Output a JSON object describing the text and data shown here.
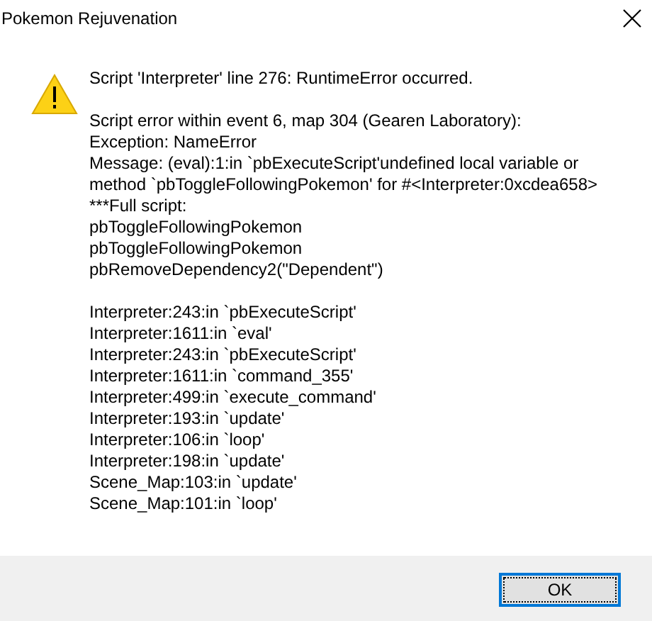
{
  "window": {
    "title": "Pokemon Rejuvenation"
  },
  "message_blocks": [
    [
      "Script 'Interpreter' line 276: RuntimeError occurred."
    ],
    [
      "Script error within event 6, map 304 (Gearen Laboratory):",
      "Exception: NameError",
      "Message: (eval):1:in `pbExecuteScript'undefined local variable or method `pbToggleFollowingPokemon' for #<Interpreter:0xcdea658>",
      "***Full script:",
      "pbToggleFollowingPokemon",
      "pbToggleFollowingPokemon",
      "pbRemoveDependency2(\"Dependent\")"
    ],
    [
      "Interpreter:243:in `pbExecuteScript'",
      "Interpreter:1611:in `eval'",
      "Interpreter:243:in `pbExecuteScript'",
      "Interpreter:1611:in `command_355'",
      "Interpreter:499:in `execute_command'",
      "Interpreter:193:in `update'",
      "Interpreter:106:in `loop'",
      "Interpreter:198:in `update'",
      "Scene_Map:103:in `update'",
      "Scene_Map:101:in `loop'"
    ]
  ],
  "buttons": [
    "OK"
  ]
}
